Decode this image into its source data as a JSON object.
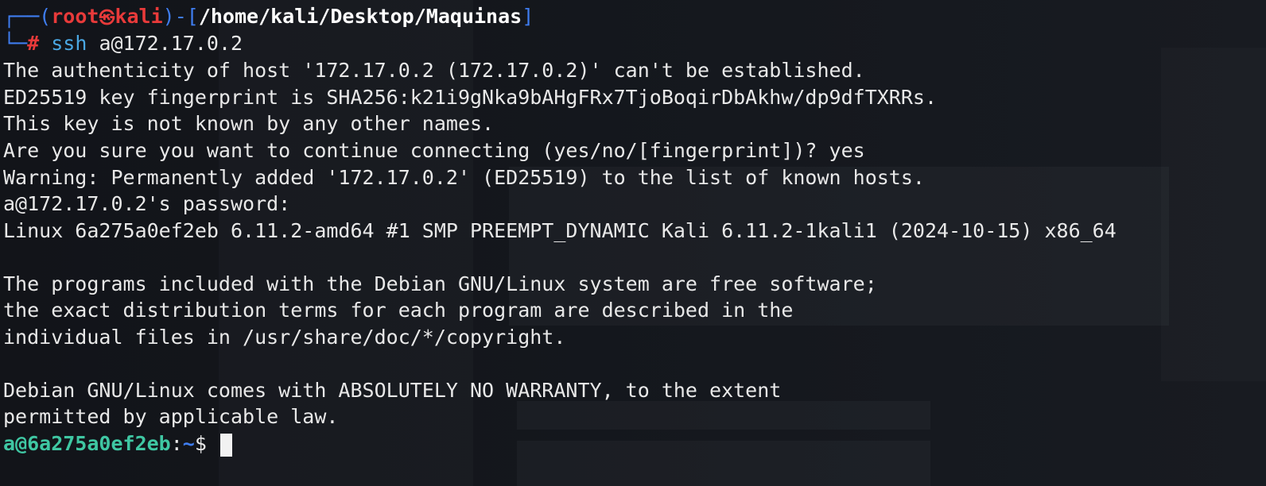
{
  "prompt_header": {
    "frame_open": "┌──(",
    "user": "root",
    "logo": "㉿",
    "host": "kali",
    "frame_mid": ")-[",
    "path": "/home/kali/Desktop/Maquinas",
    "frame_close": "]"
  },
  "command_line": {
    "frame": "└─",
    "hash": "#",
    "command": "ssh",
    "argument": "a@172.17.0.2"
  },
  "output": [
    "The authenticity of host '172.17.0.2 (172.17.0.2)' can't be established.",
    "ED25519 key fingerprint is SHA256:k21i9gNka9bAHgFRx7TjoBoqirDbAkhw/dp9dfTXRRs.",
    "This key is not known by any other names.",
    "Are you sure you want to continue connecting (yes/no/[fingerprint])? yes",
    "Warning: Permanently added '172.17.0.2' (ED25519) to the list of known hosts.",
    "a@172.17.0.2's password:",
    "Linux 6a275a0ef2eb 6.11.2-amd64 #1 SMP PREEMPT_DYNAMIC Kali 6.11.2-1kali1 (2024-10-15) x86_64",
    "The programs included with the Debian GNU/Linux system are free software;",
    "the exact distribution terms for each program are described in the",
    "individual files in /usr/share/doc/*/copyright.",
    "Debian GNU/Linux comes with ABSOLUTELY NO WARRANTY, to the extent",
    "permitted by applicable law."
  ],
  "remote_prompt": {
    "user_host": "a@6a275a0ef2eb",
    "sep": ":",
    "path": "~",
    "symbol": "$ "
  },
  "colors": {
    "background": "#121419",
    "frame": "#3f7df0",
    "root": "#e83a3a",
    "command": "#4aa7e3",
    "remote_user": "#3fc7a3"
  }
}
